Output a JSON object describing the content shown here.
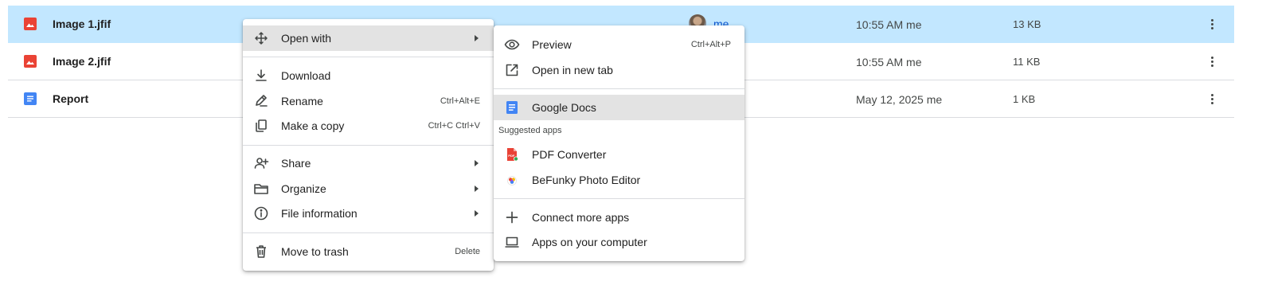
{
  "files": [
    {
      "name": "Image 1.jfif",
      "type": "image",
      "owner": "me",
      "modified": "10:55 AM me",
      "size": "13 KB",
      "selected": true
    },
    {
      "name": "Image 2.jfif",
      "type": "image",
      "owner": "",
      "modified": "10:55 AM me",
      "size": "11 KB",
      "selected": false
    },
    {
      "name": "Report",
      "type": "doc",
      "owner": "",
      "modified": "May 12, 2025 me",
      "size": "1 KB",
      "selected": false
    }
  ],
  "context_menu": {
    "items": [
      {
        "id": "open_with",
        "label": "Open with",
        "icon": "open-with-icon",
        "submenu": true,
        "highlighted": true
      },
      {
        "id": "download",
        "label": "Download",
        "icon": "download-icon"
      },
      {
        "id": "rename",
        "label": "Rename",
        "icon": "rename-icon",
        "shortcut": "Ctrl+Alt+E"
      },
      {
        "id": "make_copy",
        "label": "Make a copy",
        "icon": "copy-icon",
        "shortcut": "Ctrl+C Ctrl+V"
      },
      {
        "id": "share",
        "label": "Share",
        "icon": "share-icon",
        "submenu": true
      },
      {
        "id": "organize",
        "label": "Organize",
        "icon": "folder-icon",
        "submenu": true
      },
      {
        "id": "file_info",
        "label": "File information",
        "icon": "info-icon",
        "submenu": true
      },
      {
        "id": "trash",
        "label": "Move to trash",
        "icon": "trash-icon",
        "shortcut": "Delete"
      }
    ]
  },
  "open_with_menu": {
    "items": [
      {
        "label": "Preview",
        "icon": "eye-icon",
        "shortcut": "Ctrl+Alt+P"
      },
      {
        "label": "Open in new tab",
        "icon": "open-in-new-icon"
      },
      {
        "label": "Google Docs",
        "icon": "google-docs-icon",
        "highlighted": true
      }
    ],
    "suggested_label": "Suggested apps",
    "suggested": [
      {
        "label": "PDF Converter",
        "icon": "pdf-converter-icon"
      },
      {
        "label": "BeFunky Photo Editor",
        "icon": "befunky-icon"
      }
    ],
    "more": [
      {
        "label": "Connect more apps",
        "icon": "plus-icon"
      },
      {
        "label": "Apps on your computer",
        "icon": "laptop-icon"
      }
    ]
  },
  "colors": {
    "selected_row": "#c2e7ff",
    "accent": "#0b57d0",
    "image_icon": "#ea4335",
    "doc_icon": "#4285f4",
    "hover": "#e3e3e3"
  }
}
